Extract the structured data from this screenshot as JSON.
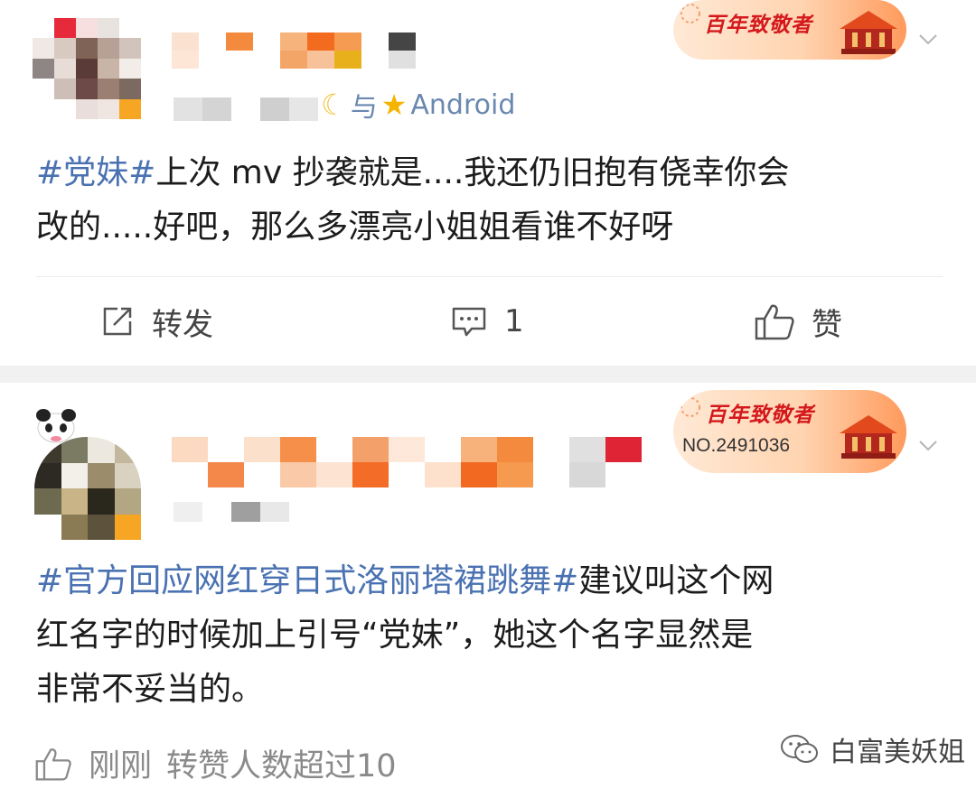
{
  "colors": {
    "topic": "#4a72b2",
    "badge_red": "#d4181c",
    "divider": "#f1f1f1"
  },
  "post1": {
    "badge_title": "百年致敬者",
    "source": {
      "joiner": "与",
      "device": "Android",
      "icons": [
        "moon-icon",
        "star-icon"
      ]
    },
    "text": {
      "topic": "#党妹#",
      "line1_rest": "上次 mv 抄袭就是....我还仍旧抱有侥幸你会",
      "line2": "改的.....好吧，那么多漂亮小姐姐看谁不好呀"
    },
    "actions": {
      "repost": "转发",
      "comments": "1",
      "like": "赞"
    }
  },
  "post2": {
    "badge_title": "百年致敬者",
    "badge_number": "NO.2491036",
    "text": {
      "topic": "#官方回应网红穿日式洛丽塔裙跳舞#",
      "line1_rest": "建议叫这个网",
      "line2": "红名字的时候加上引号“党妹”，她这个名字显然是",
      "line3": "非常不妥当的。"
    },
    "footer": {
      "time": "刚刚",
      "repost_info": "转赞人数超过10"
    },
    "watermark": "白富美妖姐"
  }
}
